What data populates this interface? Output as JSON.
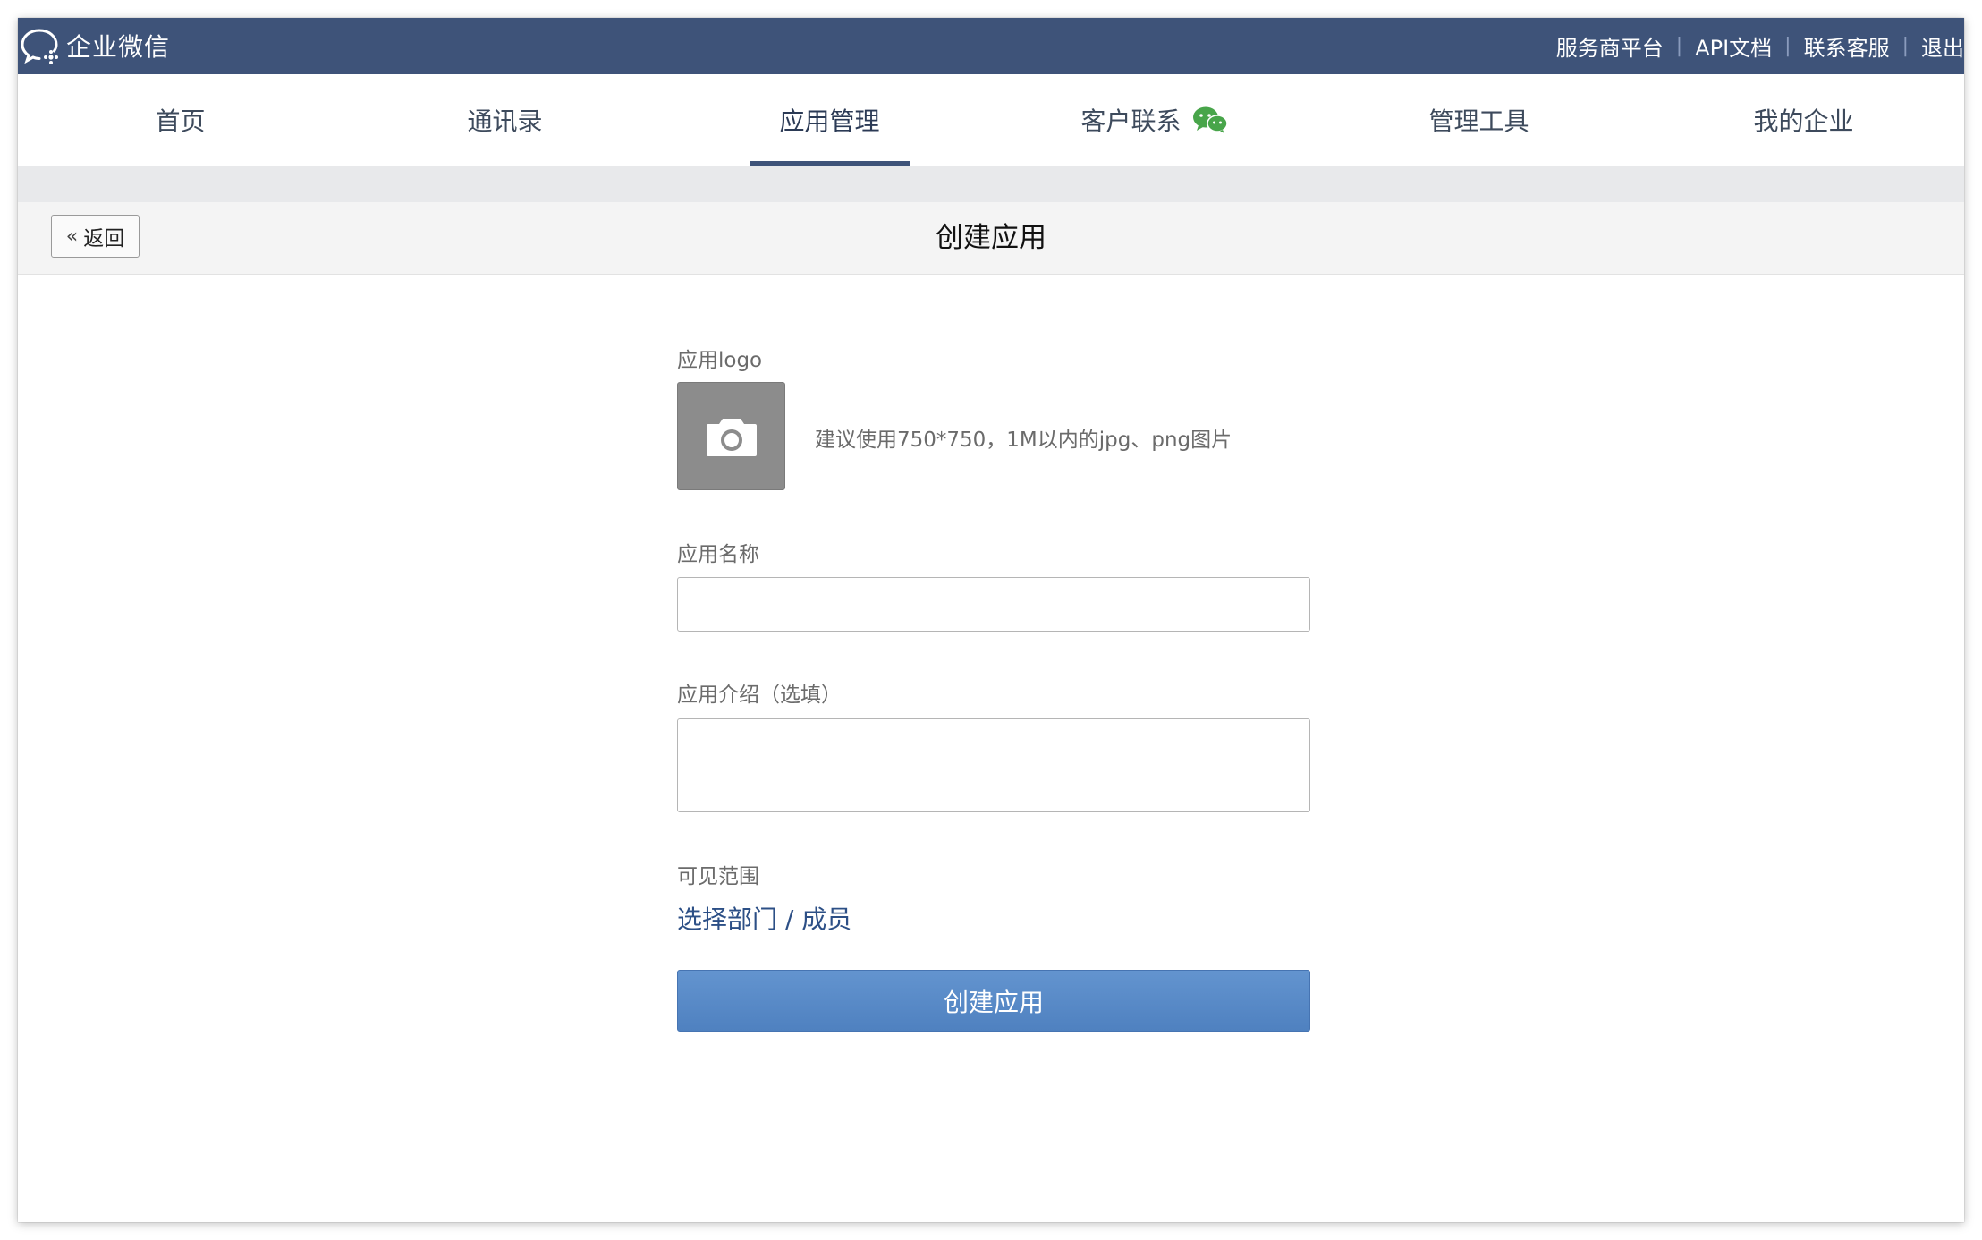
{
  "topbar": {
    "brand_icon": "wechat-work-logo-icon",
    "brand_name": "企业微信",
    "links": [
      "服务商平台",
      "API文档",
      "联系客服",
      "退出"
    ]
  },
  "nav": {
    "items": [
      "首页",
      "通讯录",
      "应用管理",
      "客户联系",
      "管理工具",
      "我的企业"
    ],
    "active_index": 2,
    "wechat_badge_icon": "wechat-icon"
  },
  "subheader": {
    "back_label": "返回",
    "back_icon": "double-chevron-left-icon",
    "title": "创建应用"
  },
  "form": {
    "logo_label": "应用logo",
    "logo_icon": "camera-icon",
    "logo_hint": "建议使用750*750，1M以内的jpg、png图片",
    "name_label": "应用名称",
    "name_value": "",
    "intro_label": "应用介绍（选填）",
    "intro_value": "",
    "visibility_label": "可见范围",
    "visibility_link": "选择部门 / 成员",
    "submit_label": "创建应用"
  },
  "colors": {
    "topbar_bg": "#3e5379",
    "primary_button": "#5b8dcb",
    "link": "#2c4f86"
  }
}
